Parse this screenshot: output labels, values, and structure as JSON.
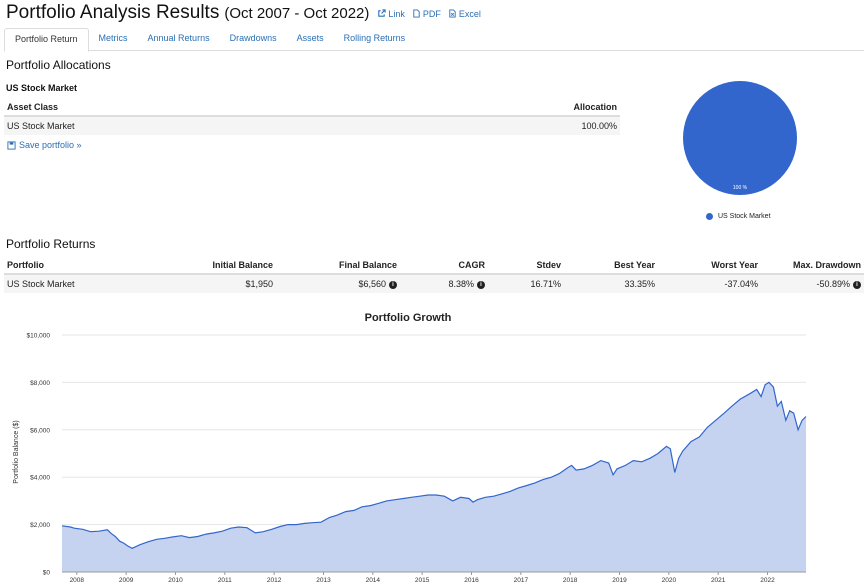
{
  "header": {
    "title": "Portfolio Analysis Results",
    "range": "(Oct 2007 - Oct 2022)",
    "links": [
      {
        "label": "Link",
        "icon": "external-link-icon"
      },
      {
        "label": "PDF",
        "icon": "pdf-file-icon"
      },
      {
        "label": "Excel",
        "icon": "excel-file-icon"
      }
    ]
  },
  "tabs": [
    "Portfolio Return",
    "Metrics",
    "Annual Returns",
    "Drawdowns",
    "Assets",
    "Rolling Returns"
  ],
  "allocations": {
    "heading": "Portfolio Allocations",
    "portfolio_name": "US Stock Market",
    "columns": [
      "Asset Class",
      "Allocation"
    ],
    "rows": [
      {
        "asset": "US Stock Market",
        "allocation": "100.00%"
      }
    ],
    "save_label": "Save portfolio »",
    "pie": {
      "label": "100 %",
      "legend": "US Stock Market",
      "color": "#3366cc"
    }
  },
  "returns": {
    "heading": "Portfolio Returns",
    "columns": [
      "Portfolio",
      "Initial Balance",
      "Final Balance",
      "CAGR",
      "Stdev",
      "Best Year",
      "Worst Year",
      "Max. Drawdown"
    ],
    "row": {
      "portfolio": "US Stock Market",
      "initial": "$1,950",
      "final": "$6,560",
      "cagr": "8.38%",
      "stdev": "16.71%",
      "best": "33.35%",
      "worst": "-37.04%",
      "maxdd": "-50.89%"
    }
  },
  "chart_data": {
    "type": "area",
    "title": "Portfolio Growth",
    "ylabel": "Portfolio Balance ($)",
    "ylim": [
      0,
      10000
    ],
    "xlim": [
      2007.75,
      2022.83
    ],
    "yticks": [
      0,
      2000,
      4000,
      6000,
      8000,
      10000
    ],
    "ytick_labels": [
      "$0",
      "$2,000",
      "$4,000",
      "$6,000",
      "$8,000",
      "$10,000"
    ],
    "xticks": [
      2008,
      2009,
      2010,
      2011,
      2012,
      2013,
      2014,
      2015,
      2016,
      2017,
      2018,
      2019,
      2020,
      2021,
      2022
    ],
    "grid": true,
    "line_color": "#3366cc",
    "fill_color": "#c5d3f0",
    "series": [
      {
        "x": [
          2007.75,
          2007.92,
          2008.0,
          2008.17,
          2008.33,
          2008.5,
          2008.67,
          2008.75,
          2008.83,
          2008.92,
          2009.0,
          2009.08,
          2009.17,
          2009.33,
          2009.5,
          2009.67,
          2009.83,
          2010.0,
          2010.17,
          2010.33,
          2010.5,
          2010.67,
          2010.83,
          2011.0,
          2011.17,
          2011.33,
          2011.5,
          2011.67,
          2011.83,
          2012.0,
          2012.17,
          2012.33,
          2012.5,
          2012.67,
          2012.83,
          2013.0,
          2013.17,
          2013.33,
          2013.5,
          2013.67,
          2013.83,
          2014.0,
          2014.17,
          2014.33,
          2014.5,
          2014.67,
          2014.83,
          2015.0,
          2015.17,
          2015.33,
          2015.5,
          2015.67,
          2015.83,
          2016.0,
          2016.08,
          2016.17,
          2016.33,
          2016.5,
          2016.67,
          2016.83,
          2017.0,
          2017.17,
          2017.33,
          2017.5,
          2017.67,
          2017.83,
          2018.0,
          2018.08,
          2018.17,
          2018.33,
          2018.5,
          2018.67,
          2018.83,
          2018.92,
          2019.0,
          2019.17,
          2019.33,
          2019.5,
          2019.67,
          2019.83,
          2020.0,
          2020.08,
          2020.17,
          2020.25,
          2020.33,
          2020.5,
          2020.67,
          2020.83,
          2021.0,
          2021.17,
          2021.33,
          2021.5,
          2021.67,
          2021.83,
          2021.92,
          2022.0,
          2022.08,
          2022.17,
          2022.25,
          2022.33,
          2022.42,
          2022.5,
          2022.58,
          2022.67,
          2022.75,
          2022.83
        ],
        "y": [
          1950,
          1900,
          1850,
          1800,
          1700,
          1720,
          1780,
          1620,
          1500,
          1300,
          1220,
          1100,
          1000,
          1150,
          1280,
          1380,
          1420,
          1480,
          1530,
          1450,
          1500,
          1600,
          1650,
          1720,
          1850,
          1900,
          1870,
          1650,
          1700,
          1800,
          1920,
          2000,
          2000,
          2050,
          2080,
          2100,
          2300,
          2400,
          2550,
          2600,
          2750,
          2800,
          2900,
          3000,
          3050,
          3100,
          3150,
          3200,
          3250,
          3250,
          3200,
          3000,
          3150,
          3100,
          2950,
          3050,
          3150,
          3200,
          3300,
          3400,
          3550,
          3650,
          3750,
          3900,
          4000,
          4150,
          4400,
          4500,
          4300,
          4350,
          4500,
          4700,
          4600,
          4100,
          4350,
          4500,
          4700,
          4650,
          4800,
          5000,
          5300,
          5200,
          4200,
          4800,
          5100,
          5500,
          5700,
          6100,
          6400,
          6700,
          7000,
          7300,
          7500,
          7700,
          7400,
          7900,
          8000,
          7800,
          7000,
          7200,
          6400,
          6800,
          6700,
          6000,
          6400,
          6560
        ]
      }
    ]
  }
}
